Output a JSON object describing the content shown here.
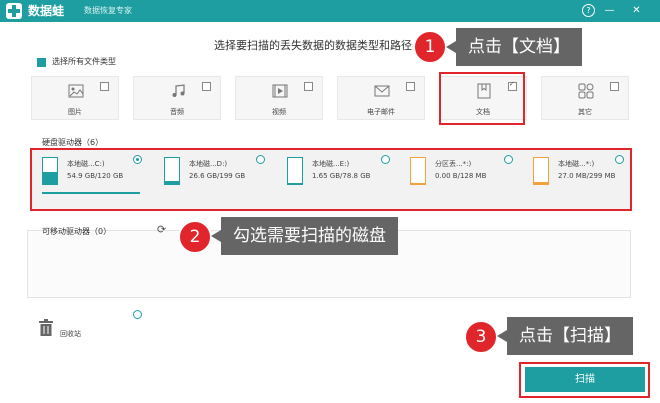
{
  "titlebar": {
    "app_name": "数据蛙",
    "subtitle": "数据恢复专家",
    "help": "?",
    "minimize": "—",
    "close": "✕"
  },
  "heading": "选择要扫描的丢失数据的数据类型和路径",
  "select_all": "选择所有文件类型",
  "file_types": [
    {
      "label": "图片",
      "icon": "image-icon",
      "checked": false
    },
    {
      "label": "音频",
      "icon": "music-icon",
      "checked": false
    },
    {
      "label": "视频",
      "icon": "video-icon",
      "checked": false
    },
    {
      "label": "电子邮件",
      "icon": "mail-icon",
      "checked": false
    },
    {
      "label": "文档",
      "icon": "document-icon",
      "checked": true
    },
    {
      "label": "其它",
      "icon": "other-icon",
      "checked": false
    }
  ],
  "hard_drives_label": "硬盘驱动器（6）",
  "drives": [
    {
      "name": "本地磁...C:)",
      "size": "54.9 GB/120 GB",
      "usage": 0.46,
      "color": "#1f9ea1",
      "selected": true
    },
    {
      "name": "本地磁...D:)",
      "size": "26.6 GB/199 GB",
      "usage": 0.13,
      "color": "#1f9ea1",
      "selected": false
    },
    {
      "name": "本地磁...E:)",
      "size": "1.65 GB/78.8 GB",
      "usage": 0.02,
      "color": "#1f9ea1",
      "selected": false
    },
    {
      "name": "分区丢...*:)",
      "size": "0.00  B/128 MB",
      "usage": 0.0,
      "color": "#f2a23c",
      "selected": false
    },
    {
      "name": "本地磁...*:)",
      "size": "27.0 MB/299 MB",
      "usage": 0.09,
      "color": "#f2a23c",
      "selected": false
    }
  ],
  "removable_label": "可移动驱动器（0）",
  "recycle_bin": "回收站",
  "scan_button": "扫描",
  "callouts": [
    {
      "number": "1",
      "text": "点击【文档】"
    },
    {
      "number": "2",
      "text": "勾选需要扫描的磁盘"
    },
    {
      "number": "3",
      "text": "点击【扫描】"
    }
  ],
  "colors": {
    "accent": "#1f9ea1",
    "highlight": "#e1262b",
    "orange": "#f2a23c"
  }
}
